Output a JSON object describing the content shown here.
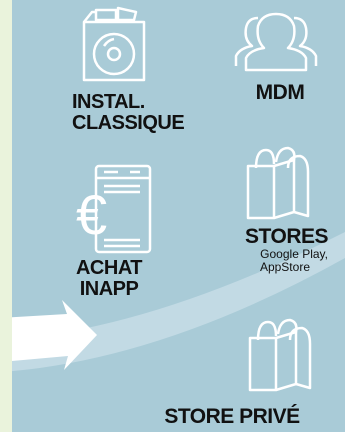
{
  "colors": {
    "background": "#a9cbd7",
    "left_strip": "#eaf3dc",
    "icon": "#ffffff",
    "text": "#111111"
  },
  "nodes": {
    "instal_classique": {
      "line1": "INSTAL.",
      "line2": "CLASSIQUE",
      "icon": "disc-box-icon"
    },
    "mdm": {
      "label": "MDM",
      "icon": "users-icon"
    },
    "stores": {
      "label": "STORES",
      "sub1": "Google Play,",
      "sub2": "AppStore",
      "icon": "shopping-bag-icon"
    },
    "achat_inapp": {
      "line1": "ACHAT",
      "line2": "INAPP",
      "icon": "euro-phone-icon"
    },
    "store_prive": {
      "label": "STORE PRIVÉ",
      "icon": "shopping-bag-icon"
    }
  }
}
